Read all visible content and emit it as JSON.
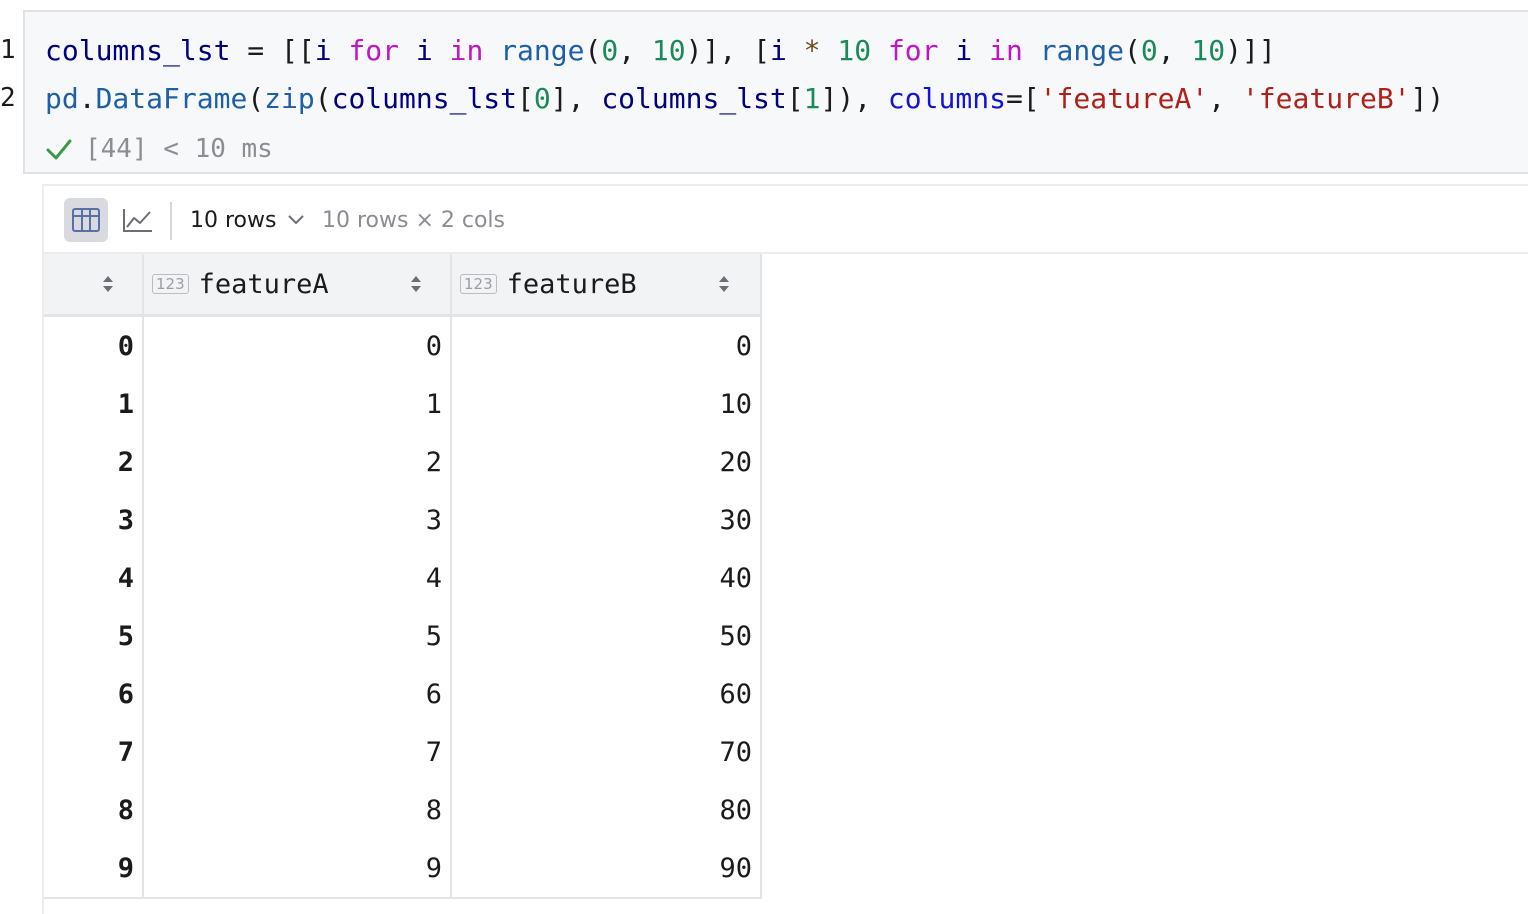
{
  "gutter": {
    "line_numbers": [
      "1",
      "2"
    ]
  },
  "code": {
    "line1": [
      {
        "t": "columns_lst",
        "c": "id"
      },
      {
        "t": " = ",
        "c": "pl"
      },
      {
        "t": "[[",
        "c": "pl"
      },
      {
        "t": "i",
        "c": "id"
      },
      {
        "t": " ",
        "c": "pl"
      },
      {
        "t": "for",
        "c": "kw"
      },
      {
        "t": " ",
        "c": "pl"
      },
      {
        "t": "i",
        "c": "id"
      },
      {
        "t": " ",
        "c": "pl"
      },
      {
        "t": "in",
        "c": "kw"
      },
      {
        "t": " ",
        "c": "pl"
      },
      {
        "t": "range",
        "c": "fn"
      },
      {
        "t": "(",
        "c": "pl"
      },
      {
        "t": "0",
        "c": "num"
      },
      {
        "t": ", ",
        "c": "pl"
      },
      {
        "t": "10",
        "c": "num"
      },
      {
        "t": ")], [",
        "c": "pl"
      },
      {
        "t": "i",
        "c": "id"
      },
      {
        "t": " ",
        "c": "pl"
      },
      {
        "t": "*",
        "c": "op"
      },
      {
        "t": " ",
        "c": "pl"
      },
      {
        "t": "10",
        "c": "num"
      },
      {
        "t": " ",
        "c": "pl"
      },
      {
        "t": "for",
        "c": "kw"
      },
      {
        "t": " ",
        "c": "pl"
      },
      {
        "t": "i",
        "c": "id"
      },
      {
        "t": " ",
        "c": "pl"
      },
      {
        "t": "in",
        "c": "kw"
      },
      {
        "t": " ",
        "c": "pl"
      },
      {
        "t": "range",
        "c": "fn"
      },
      {
        "t": "(",
        "c": "pl"
      },
      {
        "t": "0",
        "c": "num"
      },
      {
        "t": ", ",
        "c": "pl"
      },
      {
        "t": "10",
        "c": "num"
      },
      {
        "t": ")]]",
        "c": "pl"
      }
    ],
    "line2": [
      {
        "t": "pd",
        "c": "fn"
      },
      {
        "t": ".",
        "c": "pl"
      },
      {
        "t": "DataFrame",
        "c": "fn"
      },
      {
        "t": "(",
        "c": "pl"
      },
      {
        "t": "zip",
        "c": "fn"
      },
      {
        "t": "(",
        "c": "pl"
      },
      {
        "t": "columns_lst",
        "c": "id"
      },
      {
        "t": "[",
        "c": "pl"
      },
      {
        "t": "0",
        "c": "num"
      },
      {
        "t": "], ",
        "c": "pl"
      },
      {
        "t": "columns_lst",
        "c": "id"
      },
      {
        "t": "[",
        "c": "pl"
      },
      {
        "t": "1",
        "c": "num"
      },
      {
        "t": "]), ",
        "c": "pl"
      },
      {
        "t": "columns",
        "c": "kwarg"
      },
      {
        "t": "=[",
        "c": "pl"
      },
      {
        "t": "'featureA'",
        "c": "str"
      },
      {
        "t": ", ",
        "c": "pl"
      },
      {
        "t": "'featureB'",
        "c": "str"
      },
      {
        "t": "])",
        "c": "pl"
      }
    ]
  },
  "status": {
    "text": "[44] < 10 ms",
    "icon": "check-icon",
    "color": "#3a9a4a"
  },
  "toolbar": {
    "table_view_icon": "table-icon",
    "chart_view_icon": "line-chart-icon",
    "rows_label": "10 rows",
    "shape_info": "10 rows × 2 cols"
  },
  "table": {
    "type_tag": "123",
    "columns": [
      "featureA",
      "featureB"
    ],
    "rows": [
      {
        "index": "0",
        "a": "0",
        "b": "0"
      },
      {
        "index": "1",
        "a": "1",
        "b": "10"
      },
      {
        "index": "2",
        "a": "2",
        "b": "20"
      },
      {
        "index": "3",
        "a": "3",
        "b": "30"
      },
      {
        "index": "4",
        "a": "4",
        "b": "40"
      },
      {
        "index": "5",
        "a": "5",
        "b": "50"
      },
      {
        "index": "6",
        "a": "6",
        "b": "60"
      },
      {
        "index": "7",
        "a": "7",
        "b": "70"
      },
      {
        "index": "8",
        "a": "8",
        "b": "80"
      },
      {
        "index": "9",
        "a": "9",
        "b": "90"
      }
    ]
  }
}
